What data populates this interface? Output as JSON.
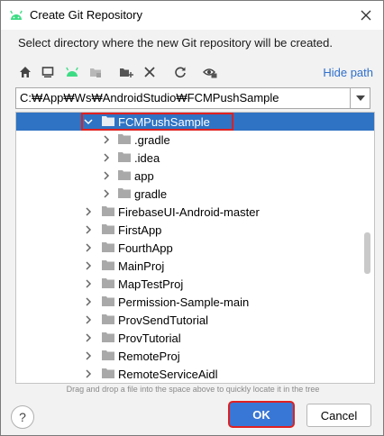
{
  "window": {
    "title": "Create Git Repository"
  },
  "description": "Select directory where the new Git repository will be created.",
  "toolbar": {
    "hide_path_label": "Hide path",
    "icons": [
      "home-icon",
      "desktop-icon",
      "android-project-icon",
      "module-icon",
      "new-folder-icon",
      "delete-icon",
      "refresh-icon",
      "show-hidden-icon"
    ]
  },
  "path": {
    "value": "C:₩App₩Ws₩AndroidStudio₩FCMPushSample"
  },
  "tree": {
    "items": [
      {
        "label": "FCMPushSample",
        "level": 1,
        "expanded": true,
        "selected": true
      },
      {
        "label": ".gradle",
        "level": 2
      },
      {
        "label": ".idea",
        "level": 2
      },
      {
        "label": "app",
        "level": 2
      },
      {
        "label": "gradle",
        "level": 2
      },
      {
        "label": "FirebaseUI-Android-master",
        "level": 1
      },
      {
        "label": "FirstApp",
        "level": 1
      },
      {
        "label": "FourthApp",
        "level": 1
      },
      {
        "label": "MainProj",
        "level": 1
      },
      {
        "label": "MapTestProj",
        "level": 1
      },
      {
        "label": "Permission-Sample-main",
        "level": 1
      },
      {
        "label": "ProvSendTutorial",
        "level": 1
      },
      {
        "label": "ProvTutorial",
        "level": 1
      },
      {
        "label": "RemoteProj",
        "level": 1
      },
      {
        "label": "RemoteServiceAidl",
        "level": 1
      }
    ]
  },
  "hint": "Drag and drop a file into the space above to quickly locate it in the tree",
  "buttons": {
    "help": "?",
    "ok": "OK",
    "cancel": "Cancel"
  },
  "colors": {
    "selection": "#2f73c4",
    "accent": "#3877d6",
    "highlight_outline": "#e02020",
    "link": "#2f6fcc",
    "android": "#3ddc84"
  }
}
